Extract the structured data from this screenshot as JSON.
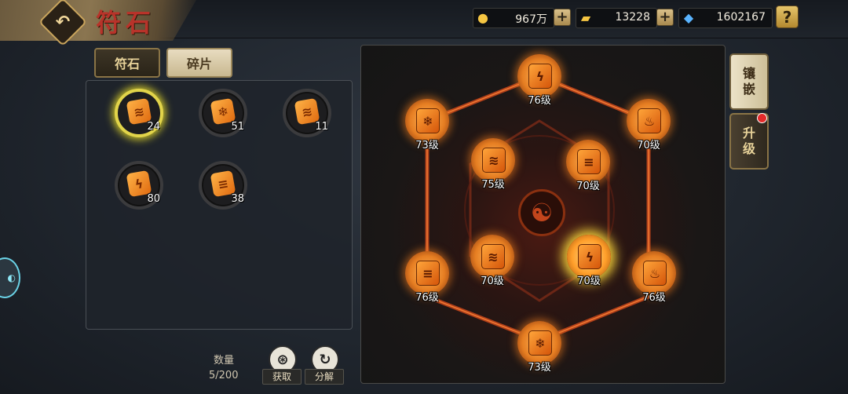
{
  "header": {
    "title": "符石",
    "back_icon": "back-arrow-icon"
  },
  "resources": [
    {
      "name": "gold",
      "icon": "gold-coin-icon",
      "value": "967万"
    },
    {
      "name": "ingot",
      "icon": "gold-ingot-icon",
      "value": "13228"
    },
    {
      "name": "crystal",
      "icon": "blue-crystal-icon",
      "value": "1602167"
    }
  ],
  "help_label": "?",
  "tabs": [
    {
      "label": "符石",
      "active": true
    },
    {
      "label": "碎片",
      "active": false
    }
  ],
  "inventory": {
    "items": [
      {
        "icon": "wind-rune-fragment-icon",
        "count": "24",
        "selected": true
      },
      {
        "icon": "ice-rune-fragment-icon",
        "count": "51",
        "selected": false
      },
      {
        "icon": "wind-rune-fragment-icon",
        "count": "11",
        "selected": false
      },
      {
        "icon": "thunder-rune-fragment-icon",
        "count": "80",
        "selected": false
      },
      {
        "icon": "tornado-rune-fragment-icon",
        "count": "38",
        "selected": false
      }
    ],
    "capacity_label": "数量",
    "capacity_value": "5/200"
  },
  "actions": [
    {
      "label": "获取",
      "icon": "obtain-icon"
    },
    {
      "label": "分解",
      "icon": "decompose-icon"
    }
  ],
  "board": {
    "center_icon": "yin-yang-bagua-icon",
    "runes": [
      {
        "slot": "top",
        "icon": "thunder-icon",
        "level": "76级"
      },
      {
        "slot": "upper-left",
        "icon": "ice-icon",
        "level": "73级"
      },
      {
        "slot": "upper-right",
        "icon": "fire-icon",
        "level": "70级"
      },
      {
        "slot": "inner-upper-left",
        "icon": "wind-icon",
        "level": "75级"
      },
      {
        "slot": "inner-upper-right",
        "icon": "tornado-icon",
        "level": "70级"
      },
      {
        "slot": "lower-left",
        "icon": "tornado-icon",
        "level": "76级"
      },
      {
        "slot": "inner-lower-left",
        "icon": "wind-icon",
        "level": "70级"
      },
      {
        "slot": "inner-lower-right",
        "icon": "thunder-icon",
        "level": "70级",
        "selected": true
      },
      {
        "slot": "lower-right",
        "icon": "fire-icon",
        "level": "76级"
      },
      {
        "slot": "bottom",
        "icon": "ice-icon",
        "level": "73级"
      }
    ]
  },
  "side": {
    "inlay_label": "镶嵌",
    "upgrade_label": "升级",
    "upgrade_has_notice": true
  },
  "colors": {
    "accent_gold": "#c9a45c",
    "rune_orange": "#e67e22",
    "title_red": "#b8332a"
  }
}
